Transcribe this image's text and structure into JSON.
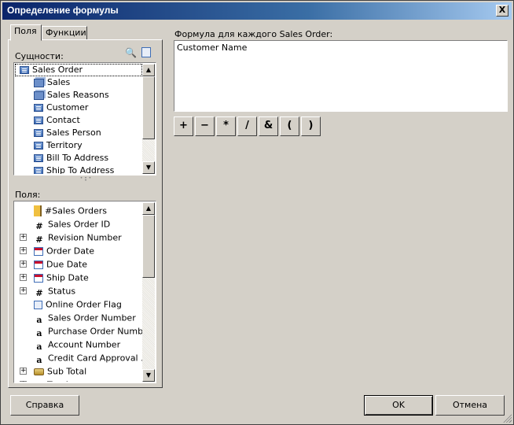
{
  "window": {
    "title": "Определение формулы",
    "close_glyph": "X"
  },
  "tabs": [
    {
      "label": "Поля"
    },
    {
      "label": "Функции"
    }
  ],
  "entities": {
    "label": "Сущности:",
    "items": [
      {
        "label": "Sales Order",
        "icon": "entity-icon",
        "selected": true
      },
      {
        "label": "Sales",
        "icon": "multi-entity-icon"
      },
      {
        "label": "Sales Reasons",
        "icon": "multi-entity-icon"
      },
      {
        "label": "Customer",
        "icon": "entity-icon"
      },
      {
        "label": "Contact",
        "icon": "entity-icon"
      },
      {
        "label": "Sales Person",
        "icon": "entity-icon"
      },
      {
        "label": "Territory",
        "icon": "entity-icon"
      },
      {
        "label": "Bill To Address",
        "icon": "entity-icon"
      },
      {
        "label": "Ship To Address",
        "icon": "entity-icon"
      }
    ]
  },
  "fields": {
    "label": "Поля:",
    "items": [
      {
        "label": "#Sales Orders",
        "icon": "aggregate-icon",
        "expandable": false
      },
      {
        "label": "Sales Order ID",
        "icon": "number-icon",
        "expandable": false
      },
      {
        "label": "Revision Number",
        "icon": "number-icon",
        "expandable": true
      },
      {
        "label": "Order Date",
        "icon": "date-icon",
        "expandable": true
      },
      {
        "label": "Due Date",
        "icon": "date-icon",
        "expandable": true
      },
      {
        "label": "Ship Date",
        "icon": "date-icon",
        "expandable": true
      },
      {
        "label": "Status",
        "icon": "number-icon",
        "expandable": true
      },
      {
        "label": "Online Order Flag",
        "icon": "boolean-icon",
        "expandable": false
      },
      {
        "label": "Sales Order Number",
        "icon": "text-icon",
        "expandable": false
      },
      {
        "label": "Purchase Order Number",
        "icon": "text-icon",
        "expandable": false
      },
      {
        "label": "Account Number",
        "icon": "text-icon",
        "expandable": false
      },
      {
        "label": "Credit Card Approval ...",
        "icon": "text-icon",
        "expandable": false
      },
      {
        "label": "Sub Total",
        "icon": "currency-icon",
        "expandable": true
      },
      {
        "label": "Tax Amt",
        "icon": "currency-icon",
        "expandable": true
      }
    ]
  },
  "formula": {
    "label": "Формула для каждого Sales Order:",
    "value": "Customer Name"
  },
  "operators": [
    "+",
    "−",
    "*",
    "/",
    "&",
    "(",
    ")"
  ],
  "buttons": {
    "help": "Справка",
    "ok": "OK",
    "cancel": "Отмена"
  },
  "glyphs": {
    "hash": "#",
    "text": "a",
    "plus": "+",
    "up": "▲",
    "down": "▼"
  }
}
